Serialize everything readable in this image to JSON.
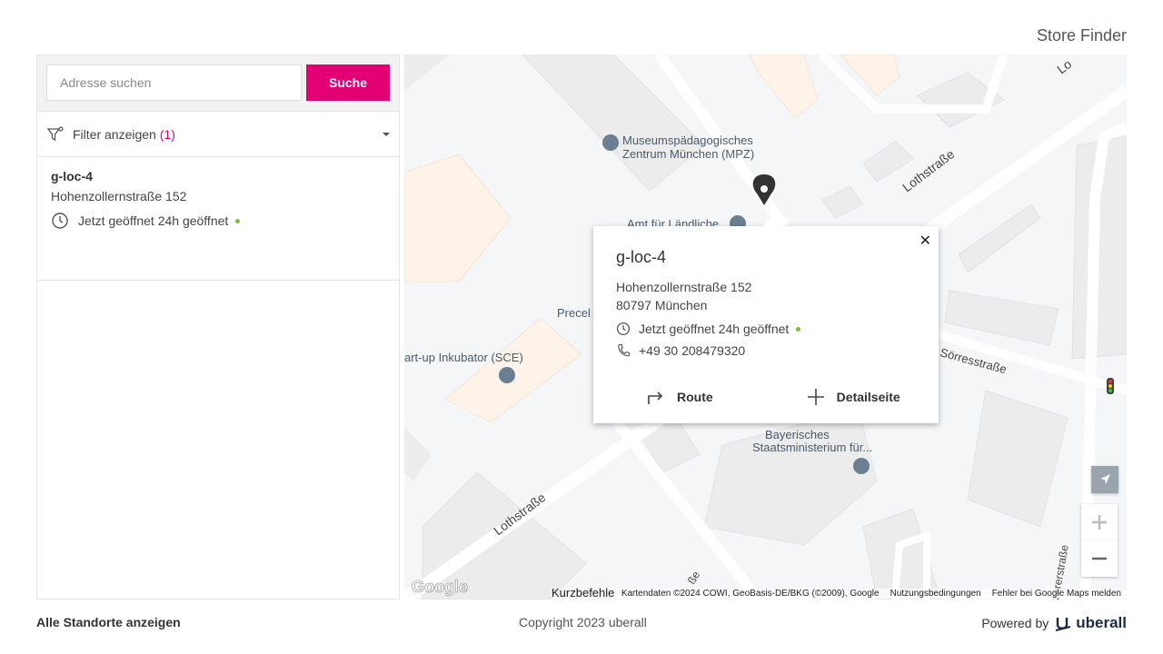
{
  "header": {
    "title": "Store Finder"
  },
  "search": {
    "placeholder": "Adresse suchen",
    "button_label": "Suche"
  },
  "filter": {
    "label": "Filter anzeigen",
    "count": "(1)"
  },
  "locations": [
    {
      "name": "g-loc-4",
      "street": "Hohenzollernstraße 152",
      "hours": "Jetzt geöffnet 24h geöffnet"
    }
  ],
  "popup": {
    "name": "g-loc-4",
    "street": "Hohenzollernstraße 152",
    "city": "80797 München",
    "hours": "Jetzt geöffnet 24h geöffnet",
    "phone": "+49 30 208479320",
    "route_label": "Route",
    "details_label": "Detailseite"
  },
  "map": {
    "poi_museum": "Museumspädagogisches",
    "poi_museum_2": "Zentrum München (MPZ)",
    "poi_amt": "Amt für Ländliche",
    "poi_precel": "Precel",
    "poi_sce": "art-up Inkubator (SCE)",
    "poi_ministry": "Bayerisches",
    "poi_ministry_2": "Staatsministerium für...",
    "street_loth_1": "Lothstraße",
    "street_loth_2": "Lothstraße",
    "street_loth_3": "Lo",
    "street_soerres": "Sörresstraße",
    "street_bottom": "nzererstraße",
    "street_bottom_2": "ße",
    "keyboard_shortcuts": "Kurzbefehle",
    "attribution": "Kartendaten ©2024 COWI, GeoBasis-DE/BKG (©2009), Google",
    "terms": "Nutzungsbedingungen",
    "report": "Fehler bei Google Maps melden",
    "google_logo": "Google"
  },
  "footer": {
    "all_locations": "Alle Standorte anzeigen",
    "copyright": "Copyright 2023 uberall",
    "powered_by": "Powered by",
    "brand": "uberall"
  },
  "colors": {
    "accent": "#e20074",
    "open": "#7cc043"
  }
}
